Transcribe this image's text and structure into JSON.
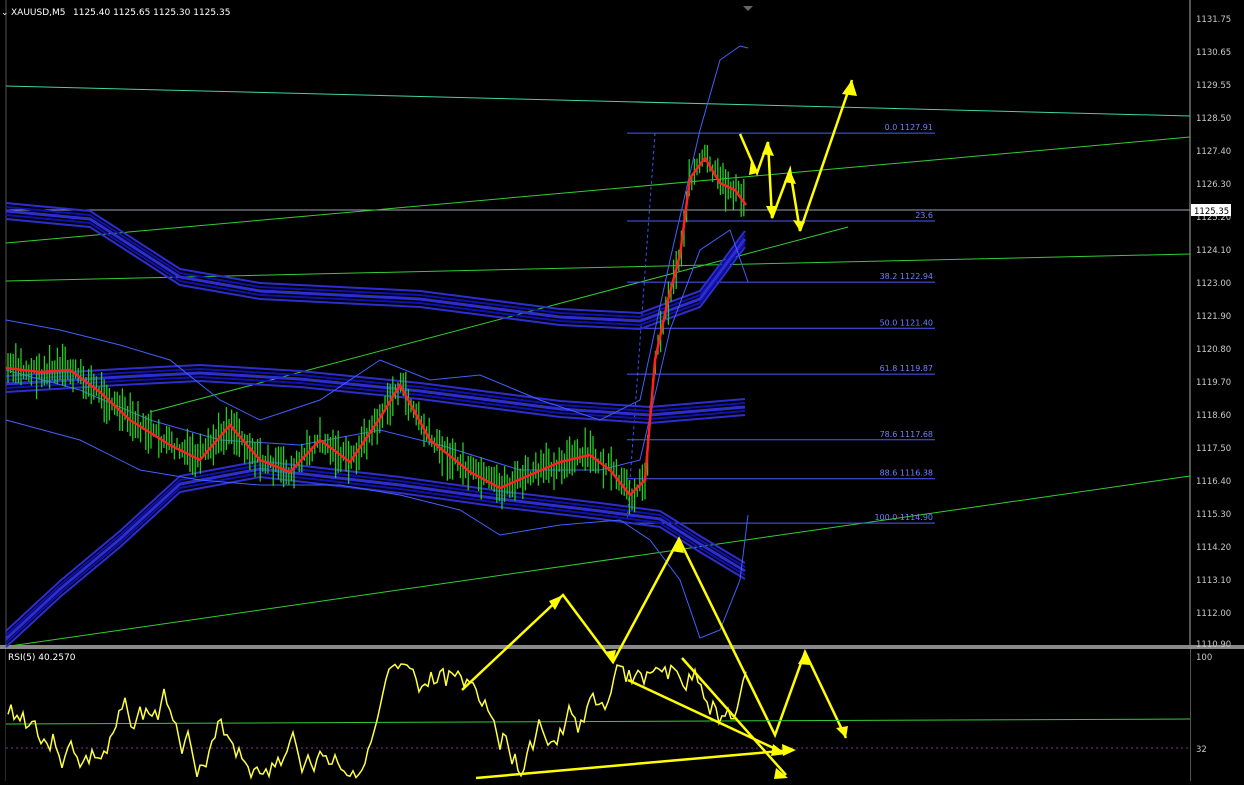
{
  "chart": {
    "symbol_label": "XAUUSD,M5",
    "ohlc_label": "1125.40 1125.65 1125.30 1125.35",
    "current_price_label": "1125.35",
    "price_axis_labels": [
      "1131.75",
      "1130.65",
      "1129.55",
      "1128.50",
      "1127.40",
      "1126.30",
      "1125.20",
      "1124.10",
      "1123.00",
      "1121.90",
      "1120.80",
      "1119.70",
      "1118.60",
      "1117.50",
      "1116.40",
      "1115.30",
      "1114.20",
      "1113.10",
      "1112.00",
      "1110.90"
    ],
    "fibonacci_levels": [
      {
        "label": "0.0 1127.91",
        "price": 1127.91
      },
      {
        "label": "23.6",
        "price": 1124.98
      },
      {
        "label": "38.2 1122.94",
        "price": 1122.94
      },
      {
        "label": "50.0 1121.40",
        "price": 1121.4
      },
      {
        "label": "61.8 1119.87",
        "price": 1119.87
      },
      {
        "label": "78.6 1117.68",
        "price": 1117.68
      },
      {
        "label": "88.6 1116.38",
        "price": 1116.38
      },
      {
        "label": "100.0 1114.90",
        "price": 1114.9
      }
    ],
    "colors": {
      "background": "#000000",
      "bars": "#22cc22",
      "moving_average": "#ff2020",
      "bands": "#1a1ac8",
      "bollinger": "#5070ff",
      "trendlines": "#33cc33",
      "fibonacci": "#5a6aff",
      "annotations": "#ffff00",
      "rsi_line": "#ffff44"
    }
  },
  "rsi": {
    "label": "RSI(5) 40.2570",
    "axis_labels": [
      "100",
      "32"
    ],
    "level_value": 32
  }
}
